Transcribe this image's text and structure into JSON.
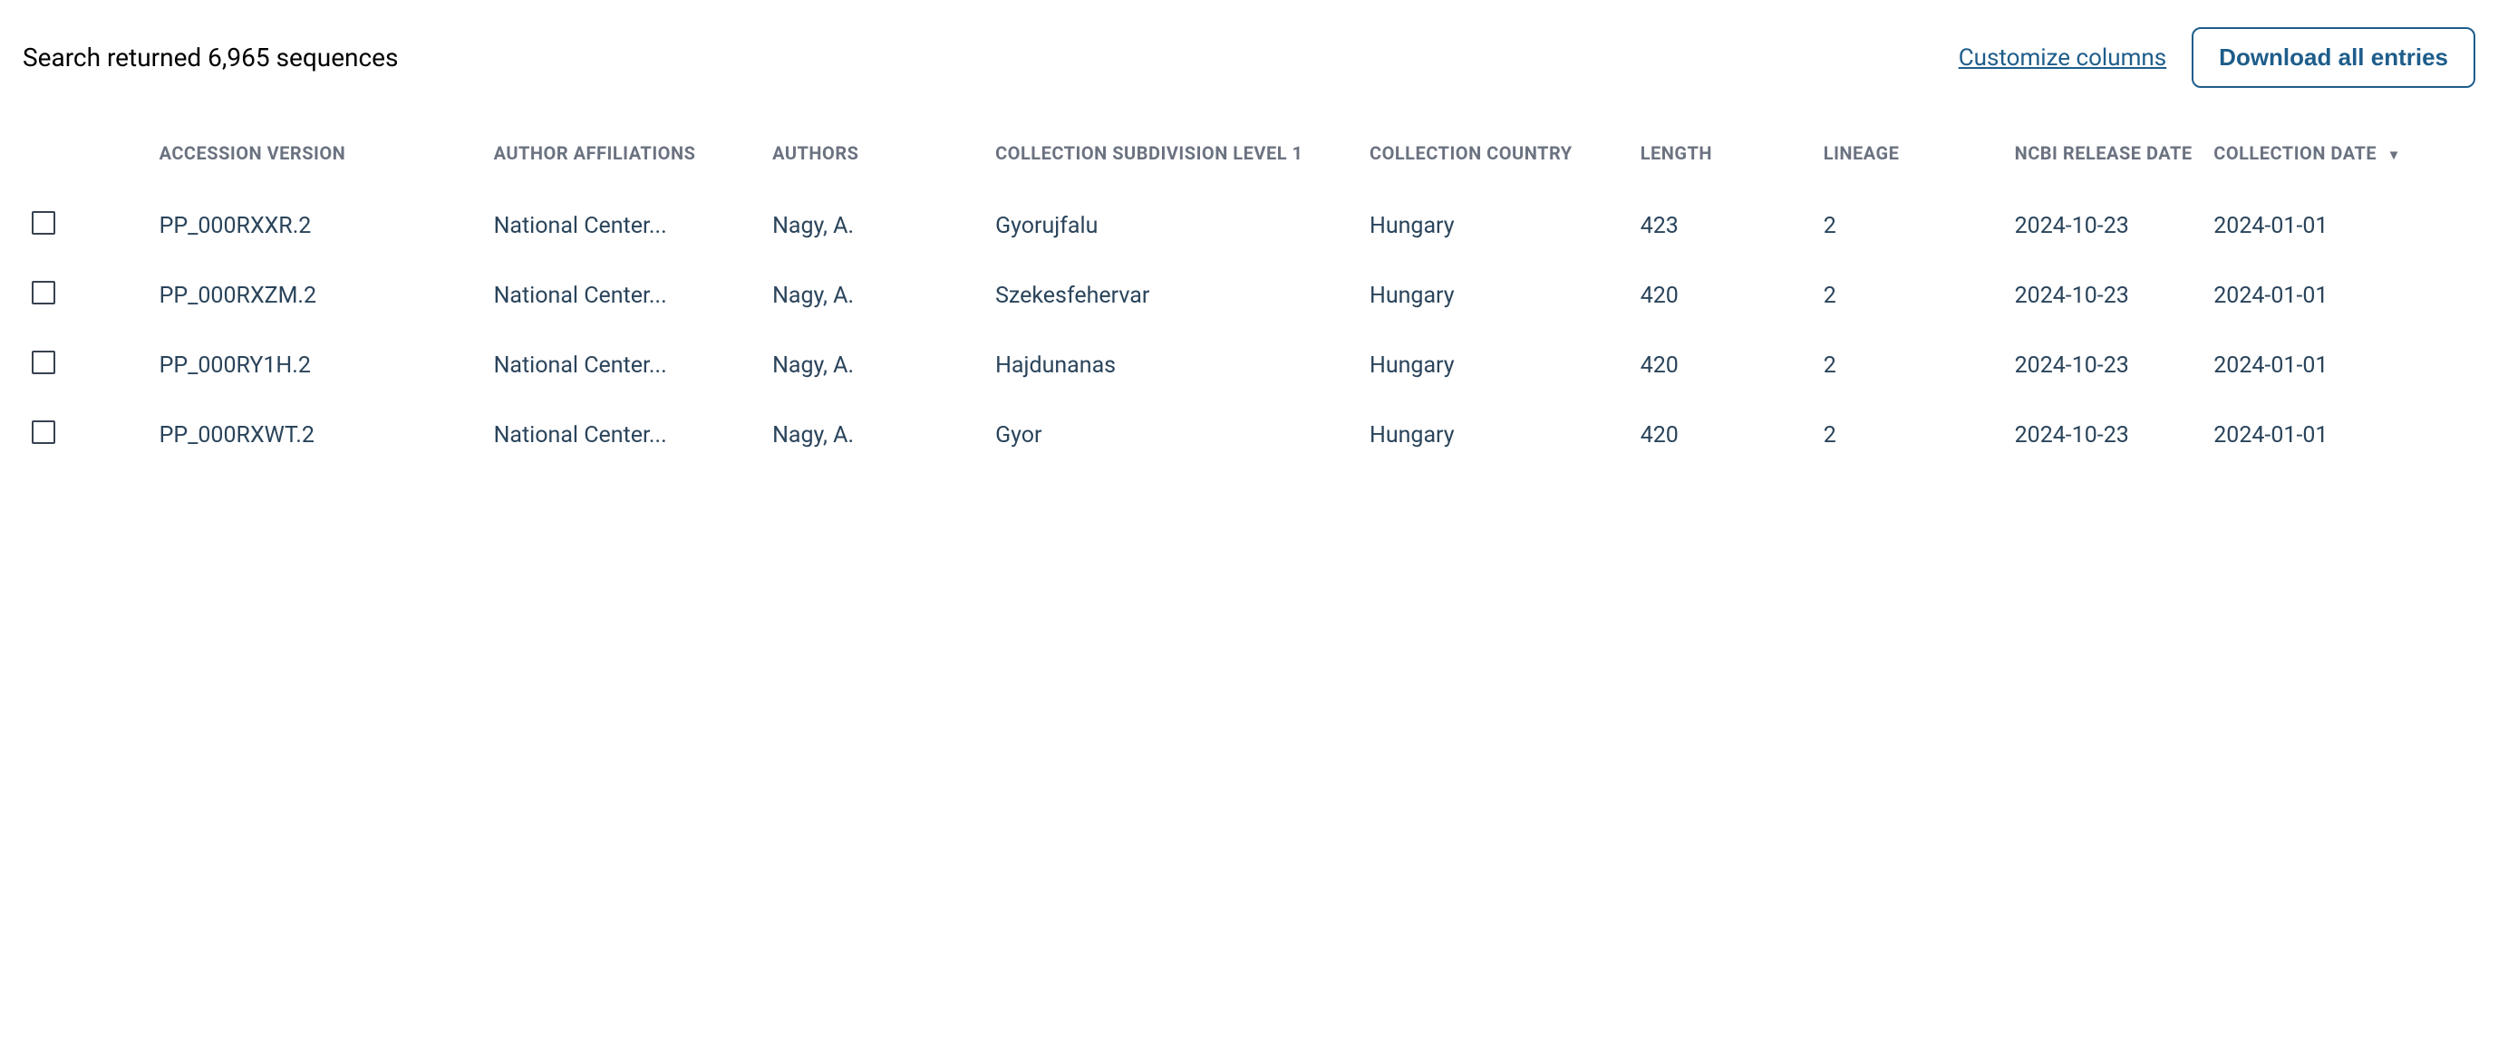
{
  "header": {
    "search_summary": "Search returned 6,965 sequences",
    "customize_label": "Customize columns",
    "download_label": "Download all entries"
  },
  "table": {
    "columns": [
      {
        "label": "ACCESSION VERSION"
      },
      {
        "label": "AUTHOR AFFILIATIONS"
      },
      {
        "label": "AUTHORS"
      },
      {
        "label": "COLLECTION SUBDIVISION LEVEL 1"
      },
      {
        "label": "COLLECTION COUNTRY"
      },
      {
        "label": "LENGTH"
      },
      {
        "label": "LINEAGE"
      },
      {
        "label": "NCBI RELEASE DATE"
      },
      {
        "label": "COLLECTION DATE",
        "sorted": "desc"
      }
    ],
    "rows": [
      {
        "accession": "PP_000RXXR.2",
        "affiliations": "National Center...",
        "authors": "Nagy, A.",
        "subdivision": "Gyorujfalu",
        "country": "Hungary",
        "length": "423",
        "lineage": "2",
        "release_date": "2024-10-23",
        "collection_date": "2024-01-01"
      },
      {
        "accession": "PP_000RXZM.2",
        "affiliations": "National Center...",
        "authors": "Nagy, A.",
        "subdivision": "Szekesfehervar",
        "country": "Hungary",
        "length": "420",
        "lineage": "2",
        "release_date": "2024-10-23",
        "collection_date": "2024-01-01"
      },
      {
        "accession": "PP_000RY1H.2",
        "affiliations": "National Center...",
        "authors": "Nagy, A.",
        "subdivision": "Hajdunanas",
        "country": "Hungary",
        "length": "420",
        "lineage": "2",
        "release_date": "2024-10-23",
        "collection_date": "2024-01-01"
      },
      {
        "accession": "PP_000RXWT.2",
        "affiliations": "National Center...",
        "authors": "Nagy, A.",
        "subdivision": "Gyor",
        "country": "Hungary",
        "length": "420",
        "lineage": "2",
        "release_date": "2024-10-23",
        "collection_date": "2024-01-01"
      }
    ]
  }
}
